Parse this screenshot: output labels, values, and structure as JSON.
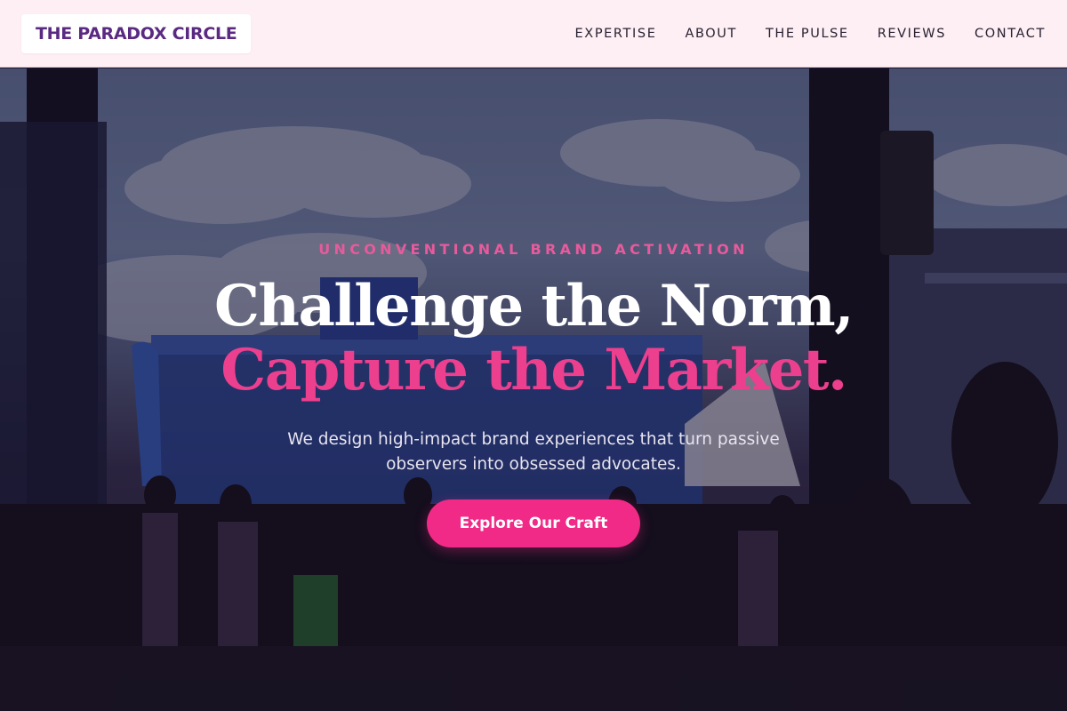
{
  "brand": {
    "name": "THE PARADOX CIRCLE"
  },
  "nav": {
    "items": [
      {
        "label": "EXPERTISE"
      },
      {
        "label": "ABOUT"
      },
      {
        "label": "THE PULSE"
      },
      {
        "label": "REVIEWS"
      },
      {
        "label": "CONTACT"
      }
    ]
  },
  "hero": {
    "eyebrow": "UNCONVENTIONAL BRAND ACTIVATION",
    "headline_line1": "Challenge the Norm,",
    "headline_line2": "Capture the Market.",
    "subtext": "We design high-impact brand experiences that turn passive observers into obsessed advocates.",
    "cta_label": "Explore Our Craft"
  },
  "colors": {
    "header_bg": "#fdeff3",
    "brand_text": "#5a2a82",
    "accent_pink": "#ec3f8e",
    "cta_bg": "#f02a86"
  }
}
